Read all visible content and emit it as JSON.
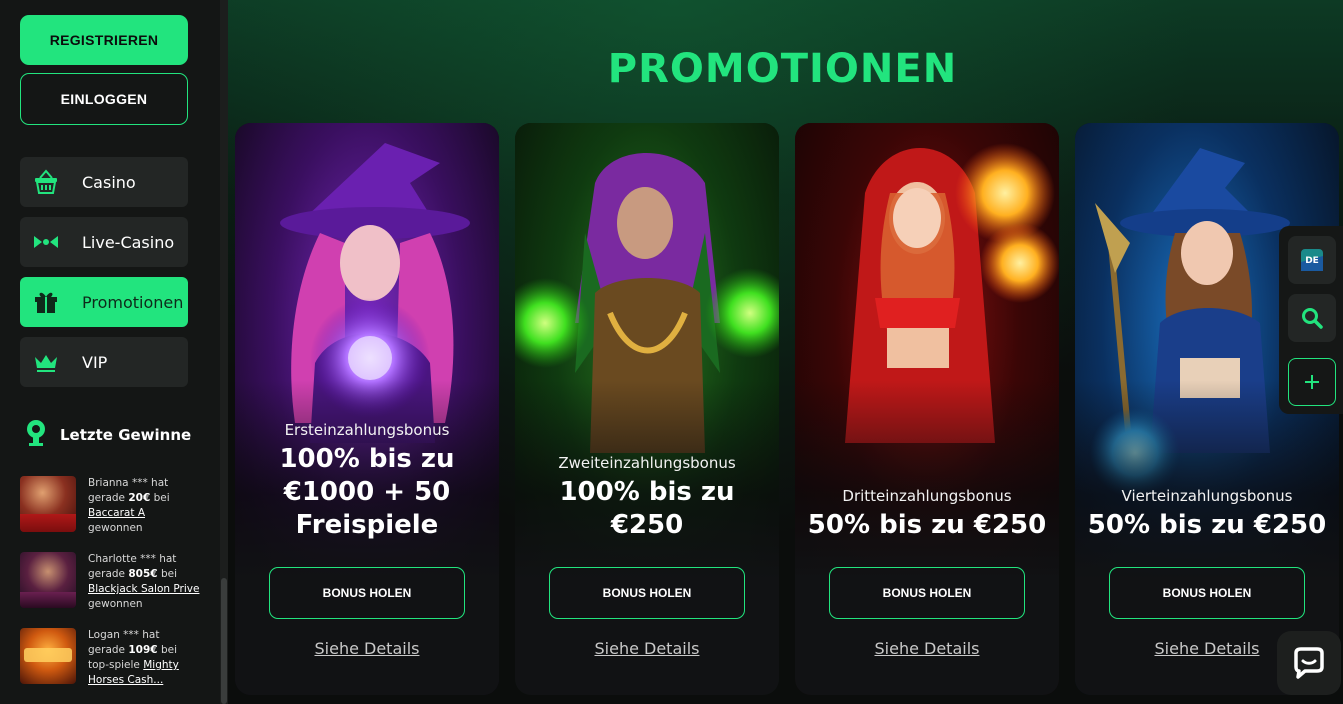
{
  "sidebar": {
    "register_label": "REGISTRIEREN",
    "login_label": "EINLOGGEN",
    "nav": [
      {
        "label": "Casino",
        "icon": "casino-basket-icon"
      },
      {
        "label": "Live-Casino",
        "icon": "live-casino-icon"
      },
      {
        "label": "Promotionen",
        "icon": "gift-icon",
        "active": true
      },
      {
        "label": "VIP",
        "icon": "crown-icon"
      }
    ],
    "recent_wins_title": "Letzte Gewinne",
    "wins": [
      {
        "user": "Brianna *** hat",
        "prefix": "gerade",
        "amount": "20€",
        "mid": "bei",
        "game": "Baccarat A",
        "suffix": "gewonnen"
      },
      {
        "user": "Charlotte *** hat",
        "prefix": "gerade",
        "amount": "805€",
        "mid": "bei",
        "game": "Blackjack Salon Prive",
        "suffix": "gewonnen"
      },
      {
        "user": "Logan *** hat",
        "prefix": "gerade",
        "amount": "109€",
        "mid": "bei top-spiele",
        "game": "Mighty Horses Cash...",
        "suffix": ""
      }
    ]
  },
  "main": {
    "title": "PROMOTIONEN",
    "cards": [
      {
        "label": "Ersteinzahlungsbonus",
        "offer_lines": [
          "100% bis zu",
          "€1000 + 50",
          "Freispiele"
        ],
        "button": "BONUS HOLEN",
        "link": "Siehe Details"
      },
      {
        "label": "Zweiteinzahlungsbonus",
        "offer_lines": [
          "100% bis zu",
          "€250"
        ],
        "button": "BONUS HOLEN",
        "link": "Siehe Details"
      },
      {
        "label": "Dritteinzahlungsbonus",
        "offer_lines": [
          "50% bis zu €250"
        ],
        "button": "BONUS HOLEN",
        "link": "Siehe Details"
      },
      {
        "label": "Vierteinzahlungsbonus",
        "offer_lines": [
          "50% bis zu €250"
        ],
        "button": "BONUS HOLEN",
        "link": "Siehe Details"
      }
    ]
  },
  "tools": {
    "language": "DE"
  },
  "colors": {
    "accent": "#22e47e",
    "sidebar_bg": "#141615",
    "nav_bg": "#232625"
  }
}
